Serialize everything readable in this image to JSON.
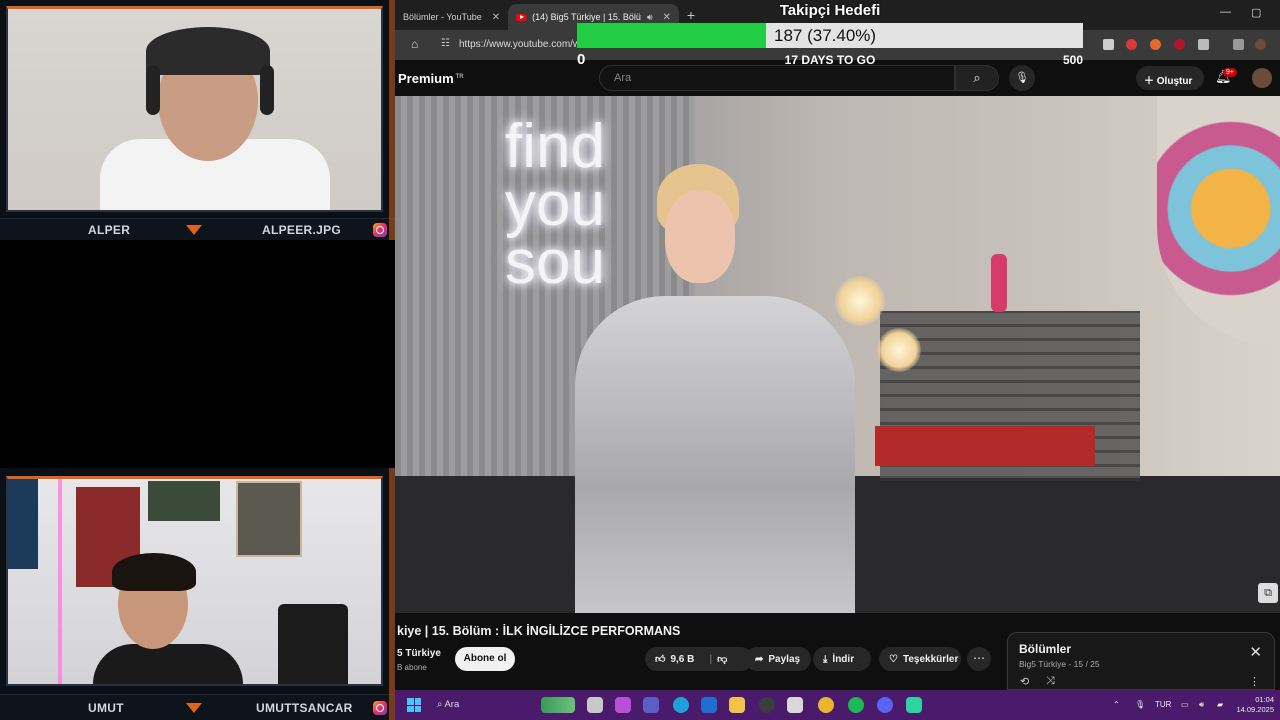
{
  "overlay": {
    "top_cam": {
      "left_name": "ALPER",
      "right_name": "ALPEER.JPG"
    },
    "bottom_cam": {
      "left_name": "UMUT",
      "right_name": "UMUTTSANCAR"
    }
  },
  "browser": {
    "tabs": [
      {
        "label": "Bölümler - YouTube",
        "close": "✕",
        "active": false
      },
      {
        "label": "(14) Big5 Türkiye | 15. Bölü",
        "close": "✕",
        "active": true
      }
    ],
    "new_tab": "+",
    "window_controls": {
      "minimize": "—",
      "maximize": "▢"
    },
    "url": "https://www.youtube.com/wa"
  },
  "goal_widget": {
    "title": "Takipçi Hedefi",
    "count_text": "187 (37.40%)",
    "progress_fraction": 0.374,
    "min": "0",
    "max": "500",
    "days_left": "17 DAYS TO GO"
  },
  "youtube": {
    "logo": "Premium",
    "region": "TR",
    "search_placeholder": "Ara",
    "create_label": "Oluştur",
    "notification_count": "9+",
    "video": {
      "neon_text": "find\nyou\nsou",
      "title": "kiye | 15. Bölüm : İLK İNGİLİZCE PERFORMANS",
      "channel": "5 Türkiye",
      "subscribers": "B abone",
      "subscribe_label": "Abone ol",
      "likes": "9,6 B",
      "share_label": "Paylaş",
      "download_label": "İndir",
      "thanks_label": "Teşekkürler"
    },
    "episodes_panel": {
      "title": "Bölümler",
      "subtitle": "Big5 Türkiye - 15 / 25"
    }
  },
  "taskbar": {
    "search_label": "Ara",
    "language": "TUR",
    "time": "01:04",
    "date": "14.09.2025"
  },
  "colors": {
    "overlay_accent": "#e0641c",
    "goal_fill": "#22cc44",
    "taskbar": "#4a1a6b",
    "youtube_red": "#ff0000"
  }
}
